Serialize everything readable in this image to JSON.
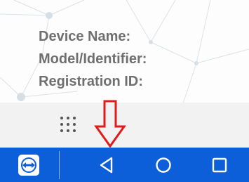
{
  "device_info": {
    "device_name_label": "Device Name:",
    "model_label": "Model/Identifier:",
    "registration_label": "Registration ID:"
  },
  "launcher": {
    "apps_icon": "app-grid-icon"
  },
  "annotation": {
    "arrow_icon": "down-arrow-icon",
    "arrow_color": "#e11a1a"
  },
  "navbar": {
    "background": "#0c5fd8",
    "buttons": [
      {
        "icon": "teamviewer-icon"
      },
      {
        "icon": "back-icon"
      },
      {
        "icon": "home-icon"
      },
      {
        "icon": "recents-icon"
      }
    ]
  }
}
